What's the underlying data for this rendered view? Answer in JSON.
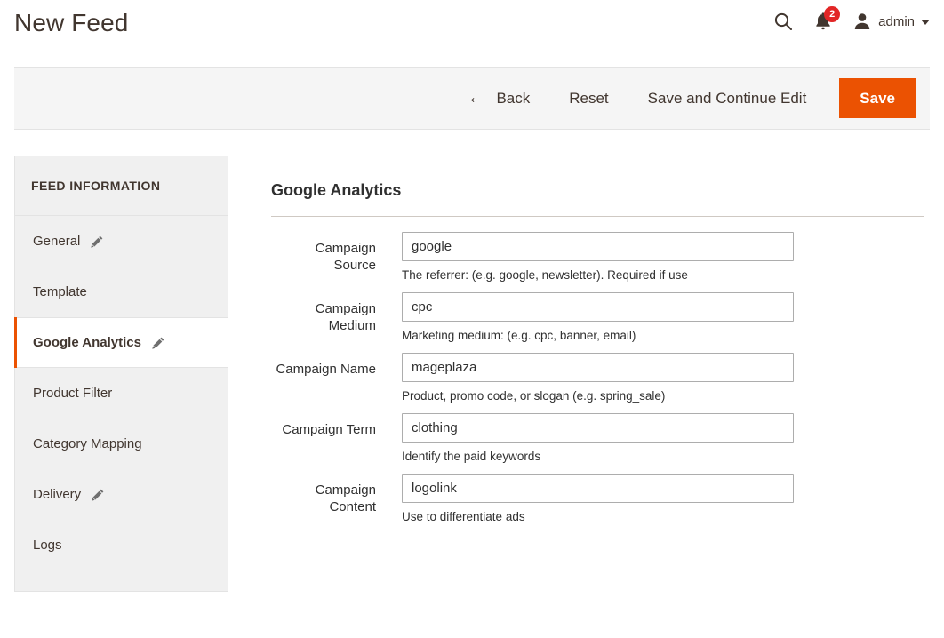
{
  "header": {
    "title": "New Feed",
    "search_icon": "search-icon",
    "notifications": {
      "icon": "bell-icon",
      "count": "2",
      "badge_color": "#e22626"
    },
    "user": {
      "icon": "user-avatar-icon",
      "name": "admin",
      "caret": "chevron-down-icon"
    }
  },
  "toolbar": {
    "back_label": "Back",
    "back_icon": "arrow-left-icon",
    "reset_label": "Reset",
    "save_continue_label": "Save and Continue Edit",
    "save_label": "Save",
    "save_color": "#eb5202"
  },
  "sidebar": {
    "title": "FEED INFORMATION",
    "accent_color": "#eb5202",
    "items": [
      {
        "label": "General",
        "icon": "pencil-icon",
        "has_icon": true,
        "active": false
      },
      {
        "label": "Template",
        "icon": "",
        "has_icon": false,
        "active": false
      },
      {
        "label": "Google Analytics",
        "icon": "pencil-icon",
        "has_icon": true,
        "active": true
      },
      {
        "label": "Product Filter",
        "icon": "",
        "has_icon": false,
        "active": false
      },
      {
        "label": "Category Mapping",
        "icon": "",
        "has_icon": false,
        "active": false
      },
      {
        "label": "Delivery",
        "icon": "pencil-icon",
        "has_icon": true,
        "active": false
      },
      {
        "label": "Logs",
        "icon": "",
        "has_icon": false,
        "active": false
      }
    ]
  },
  "main": {
    "section_title": "Google Analytics",
    "fields": [
      {
        "label": "Campaign Source",
        "value": "google",
        "note": "The referrer: (e.g. google, newsletter). Required if use"
      },
      {
        "label": "Campaign Medium",
        "value": "cpc",
        "note": "Marketing medium: (e.g. cpc, banner, email)"
      },
      {
        "label": "Campaign Name",
        "value": "mageplaza",
        "note": "Product, promo code, or slogan (e.g. spring_sale)"
      },
      {
        "label": "Campaign Term",
        "value": "clothing",
        "note": "Identify the paid keywords"
      },
      {
        "label": "Campaign Content",
        "value": "logolink",
        "note": "Use to differentiate ads"
      }
    ]
  }
}
